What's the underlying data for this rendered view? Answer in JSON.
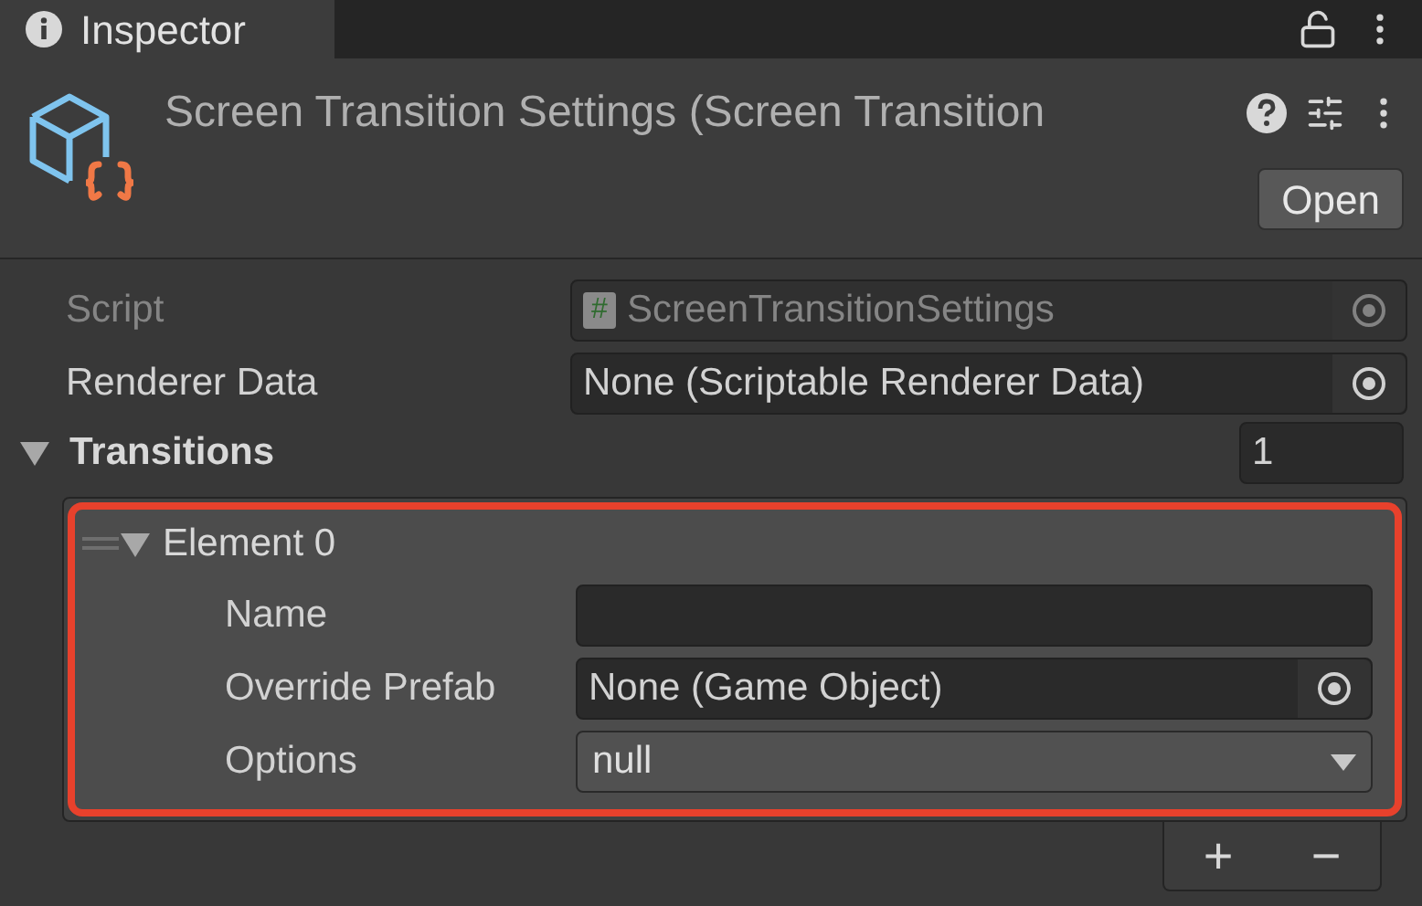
{
  "tab": {
    "title": "Inspector",
    "selected": true
  },
  "header": {
    "title": "Screen Transition Settings (Screen Transition",
    "open_button": "Open"
  },
  "fields": [
    {
      "label": "Script",
      "kind": "script",
      "script_mark": "#",
      "value": "ScreenTransitionSettings",
      "disabled": true
    },
    {
      "label": "Renderer Data",
      "kind": "object",
      "value": "None (Scriptable Renderer Data)",
      "disabled": false
    }
  ],
  "transitions": {
    "label": "Transitions",
    "expanded": true,
    "size": "1",
    "add": "+",
    "remove": "−",
    "elements": [
      {
        "label": "Element 0",
        "expanded": true,
        "highlighted": true,
        "fields": [
          {
            "label": "Name",
            "kind": "text"
          },
          {
            "label": "Override Prefab",
            "kind": "object",
            "value": "None (Game Object)"
          },
          {
            "label": "Options",
            "kind": "dropdown",
            "value": "null"
          }
        ]
      }
    ]
  }
}
